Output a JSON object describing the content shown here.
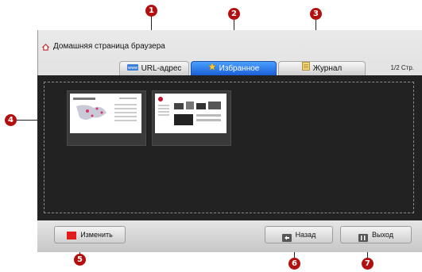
{
  "header": {
    "title": "Домашняя страница браузера"
  },
  "tabs": [
    {
      "label": "URL-адрес",
      "active": false,
      "icon": "url-icon"
    },
    {
      "label": "Избранное",
      "active": true,
      "icon": "star-icon"
    },
    {
      "label": "Журнал",
      "active": false,
      "icon": "history-icon"
    }
  ],
  "page_indicator": "1/2 Стр.",
  "bookmarks": [
    {
      "thumbnail": "site-thumbnail-1"
    },
    {
      "thumbnail": "site-thumbnail-2-lg"
    }
  ],
  "footer": {
    "edit_label": "Изменить",
    "back_label": "Назад",
    "exit_label": "Выход"
  },
  "callouts": [
    "1",
    "2",
    "3",
    "4",
    "5",
    "6",
    "7"
  ],
  "colors": {
    "callout": "#b40f0f",
    "active_tab": "#1b5fd6",
    "edit_button": "#e11d1d"
  }
}
